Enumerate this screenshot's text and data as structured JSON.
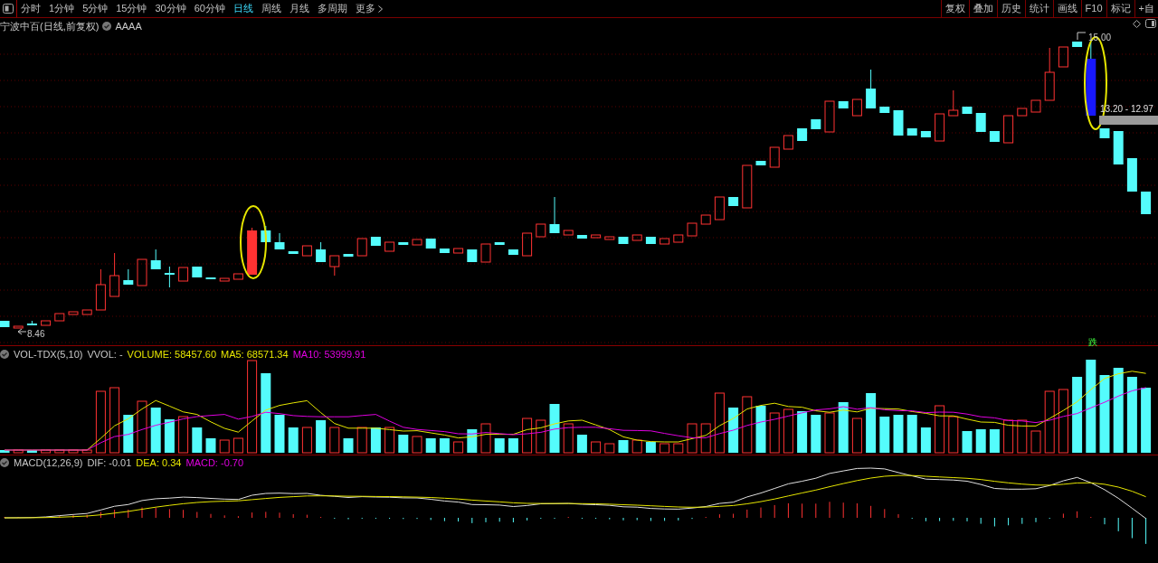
{
  "toolbar": {
    "tabs": [
      {
        "label": "分时",
        "selected": false
      },
      {
        "label": "1分钟",
        "selected": false
      },
      {
        "label": "5分钟",
        "selected": false
      },
      {
        "label": "15分钟",
        "selected": false
      },
      {
        "label": "30分钟",
        "selected": false
      },
      {
        "label": "60分钟",
        "selected": false
      },
      {
        "label": "日线",
        "selected": true
      },
      {
        "label": "周线",
        "selected": false
      },
      {
        "label": "月线",
        "selected": false
      },
      {
        "label": "多周期",
        "selected": false
      },
      {
        "label": "更多",
        "selected": false
      }
    ],
    "buttons": [
      "复权",
      "叠加",
      "历史",
      "统计",
      "画线",
      "F10",
      "标记",
      "+自"
    ]
  },
  "chart_header": {
    "title": "宁波中百(日线,前复权)",
    "tag": "AAAA"
  },
  "price_labels": {
    "high": "15.00",
    "low": "8.46",
    "range": "13.20 - 12.97",
    "signal": "跌"
  },
  "volume_legend": [
    {
      "text": "VOL-TDX(5,10)",
      "color": "#c8c8c8"
    },
    {
      "text": "VVOL: -",
      "color": "#c8c8c8"
    },
    {
      "text": "VOLUME: 58457.60",
      "color": "#e6e600"
    },
    {
      "text": "MA5: 68571.34",
      "color": "#e6e600"
    },
    {
      "text": "MA10: 53999.91",
      "color": "#e000e0"
    }
  ],
  "macd_legend": [
    {
      "text": "MACD(12,26,9)",
      "color": "#c8c8c8"
    },
    {
      "text": "DIF: -0.01",
      "color": "#c8c8c8"
    },
    {
      "text": "DEA: 0.34",
      "color": "#e6e600"
    },
    {
      "text": "MACD: -0.70",
      "color": "#e000e0"
    }
  ]
}
